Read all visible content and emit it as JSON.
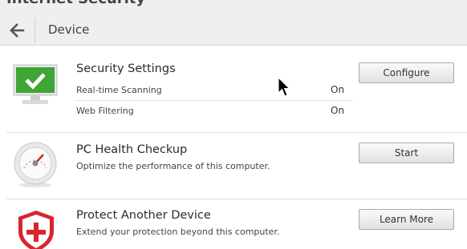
{
  "app": {
    "title": "Internet Security"
  },
  "header": {
    "page_title": "Device"
  },
  "security": {
    "title": "Security Settings",
    "button": "Configure",
    "settings": [
      {
        "label": "Real-time Scanning",
        "value": "On"
      },
      {
        "label": "Web Filtering",
        "value": "On"
      }
    ]
  },
  "health": {
    "title": "PC Health Checkup",
    "subtitle": "Optimize the performance of this computer.",
    "button": "Start"
  },
  "protect": {
    "title": "Protect Another Device",
    "subtitle": "Extend your protection beyond this computer.",
    "button": "Learn More"
  },
  "colors": {
    "accent_green": "#3fa535",
    "accent_red": "#d7262c"
  },
  "icons": [
    "back-arrow-icon",
    "monitor-check-icon",
    "gauge-icon",
    "shield-plus-icon",
    "mouse-cursor-icon"
  ]
}
